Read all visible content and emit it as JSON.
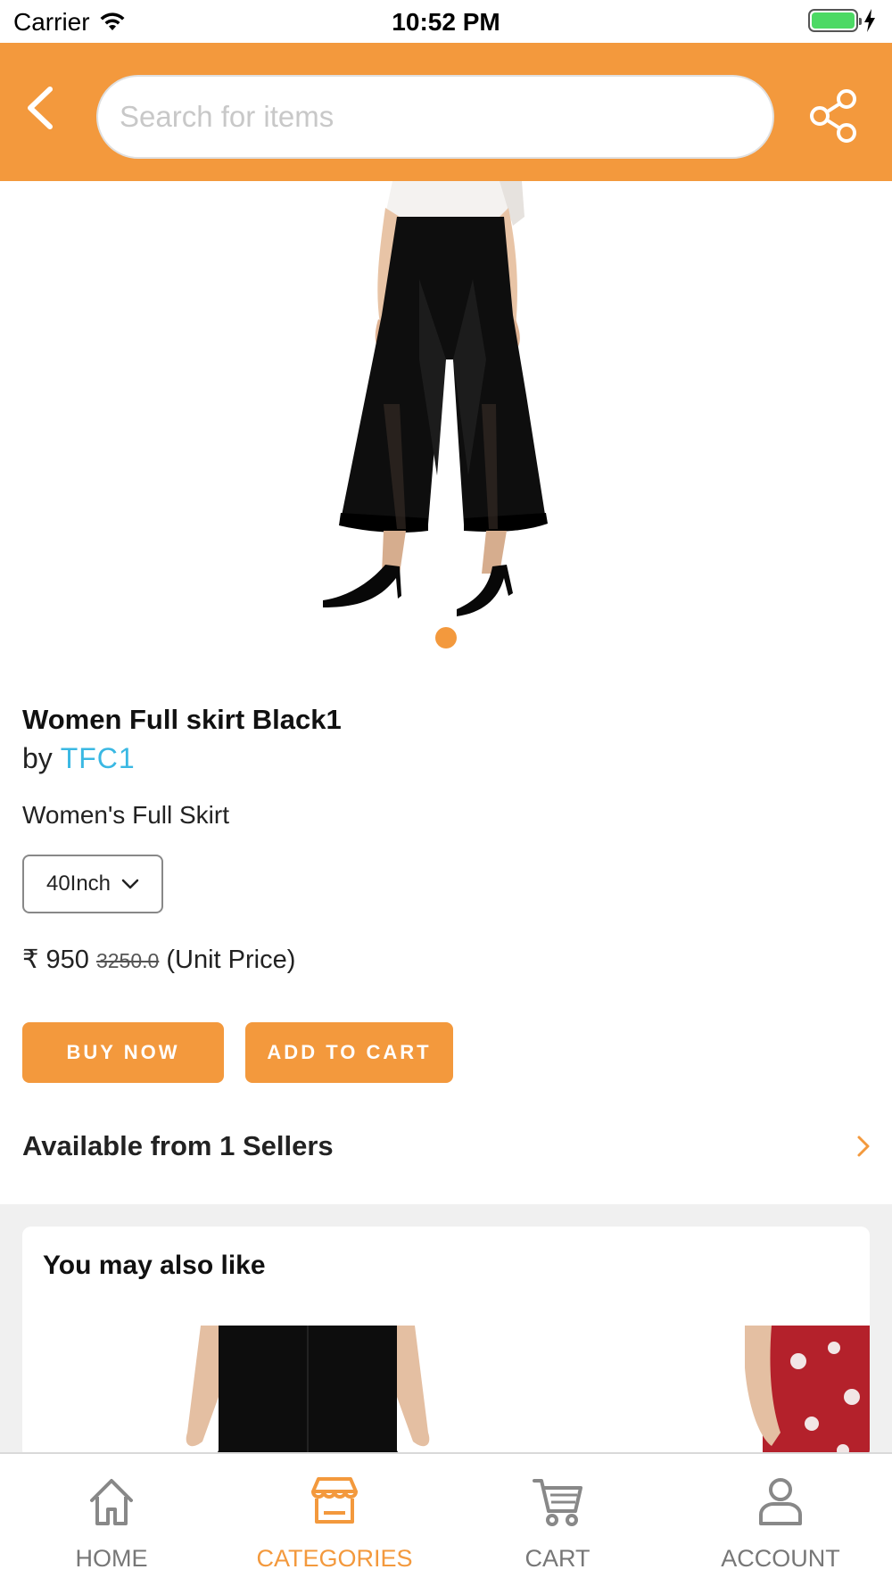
{
  "status_bar": {
    "carrier": "Carrier",
    "time": "10:52 PM",
    "battery_color": "#4cd964"
  },
  "header": {
    "background": "#f3993d",
    "back_icon": "chevron-left-icon",
    "search_placeholder": "Search for items",
    "search_value": "",
    "share_icon": "share-icon"
  },
  "product": {
    "title": "Women Full skirt Black1",
    "by_prefix": "by",
    "seller": "TFC1",
    "subtitle": "Women's Full Skirt",
    "size_selected": "40Inch",
    "currency": "₹",
    "price": "950",
    "original_price": "3250.0",
    "price_suffix": "(Unit Price)",
    "image_count_dots": 1
  },
  "actions": {
    "buy_now": "BUY NOW",
    "add_to_cart": "ADD TO CART"
  },
  "sellers": {
    "label": "Available from 1 Sellers"
  },
  "suggestions": {
    "title": "You may also like"
  },
  "tab_bar": {
    "tabs": [
      {
        "label": "HOME",
        "icon": "home-icon",
        "active": false
      },
      {
        "label": "CATEGORIES",
        "icon": "store-icon",
        "active": true
      },
      {
        "label": "CART",
        "icon": "cart-icon",
        "active": false
      },
      {
        "label": "ACCOUNT",
        "icon": "user-icon",
        "active": false
      }
    ]
  },
  "colors": {
    "accent": "#f3993d",
    "link": "#3ab8e3",
    "inactive_tab": "#777777"
  }
}
